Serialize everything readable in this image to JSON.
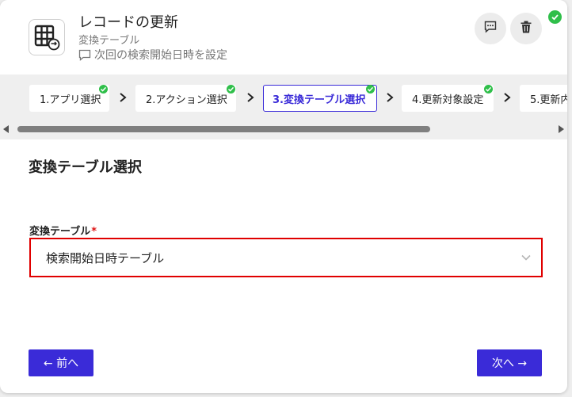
{
  "header": {
    "title": "レコードの更新",
    "subtitle": "変換テーブル",
    "description": "次回の検索開始日時を設定",
    "icons": {
      "app": "table-sync-icon",
      "comment": "comment-icon",
      "delete": "trash-icon",
      "status": "check-icon"
    }
  },
  "steps": [
    {
      "label": "1.アプリ選択",
      "completed": true,
      "active": false
    },
    {
      "label": "2.アクション選択",
      "completed": true,
      "active": false
    },
    {
      "label": "3.変換テーブル選択",
      "completed": true,
      "active": true
    },
    {
      "label": "4.更新対象設定",
      "completed": true,
      "active": false
    },
    {
      "label": "5.更新内",
      "completed": false,
      "active": false
    }
  ],
  "section": {
    "title": "変換テーブル選択"
  },
  "form": {
    "label": "変換テーブル",
    "required_mark": "*",
    "selected_value": "検索開始日時テーブル"
  },
  "buttons": {
    "prev": "← 前へ",
    "next": "次へ →"
  },
  "colors": {
    "accent": "#3a2bd8",
    "success": "#2fbf4a",
    "error_border": "#e00000"
  }
}
